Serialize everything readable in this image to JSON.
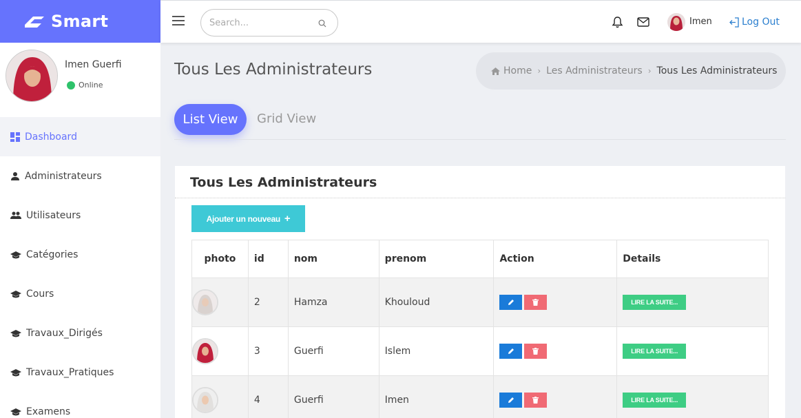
{
  "brand": {
    "name": "Smart"
  },
  "header": {
    "search_placeholder": "Search...",
    "user_name": "Imen",
    "logout_label": "Log Out"
  },
  "sidebar": {
    "profile_name": "Imen Guerfi",
    "status": "Online",
    "items": [
      {
        "label": "Dashboard",
        "icon": "dashboard-icon",
        "active": true
      },
      {
        "label": "Administrateurs",
        "icon": "person-icon"
      },
      {
        "label": "Utilisateurs",
        "icon": "people-icon"
      },
      {
        "label": "Catégories",
        "icon": "graduation-cap-icon"
      },
      {
        "label": "Cours",
        "icon": "graduation-cap-icon"
      },
      {
        "label": "Travaux_Dirigés",
        "icon": "graduation-cap-icon"
      },
      {
        "label": "Travaux_Pratiques",
        "icon": "graduation-cap-icon"
      },
      {
        "label": "Examens",
        "icon": "graduation-cap-icon"
      }
    ]
  },
  "page": {
    "title": "Tous Les Administrateurs",
    "breadcrumb": [
      "Home",
      "Les Administrateurs",
      "Tous Les Administrateurs"
    ]
  },
  "tabs": {
    "list": "List View",
    "grid": "Grid View"
  },
  "card": {
    "title": "Tous Les Administrateurs",
    "add_label": "Ajouter un nouveau",
    "add_icon": "plus-icon"
  },
  "table": {
    "headers": [
      "photo",
      "id",
      "nom",
      "prenom",
      "Action",
      "Details"
    ],
    "rows": [
      {
        "id": "2",
        "nom": "Hamza",
        "prenom": "Khouloud",
        "details": "LIRE LA SUITE..."
      },
      {
        "id": "3",
        "nom": "Guerfi",
        "prenom": "Islem",
        "details": "LIRE LA SUITE..."
      },
      {
        "id": "4",
        "nom": "Guerfi",
        "prenom": "Imen",
        "details": "LIRE LA SUITE..."
      }
    ]
  },
  "colors": {
    "brand": "#6673fd",
    "add_button": "#3ec9d6",
    "edit_button": "#1a7bd9",
    "delete_button": "#f06a74",
    "read_more_button": "#3ecd84",
    "online": "#2ec26b"
  }
}
